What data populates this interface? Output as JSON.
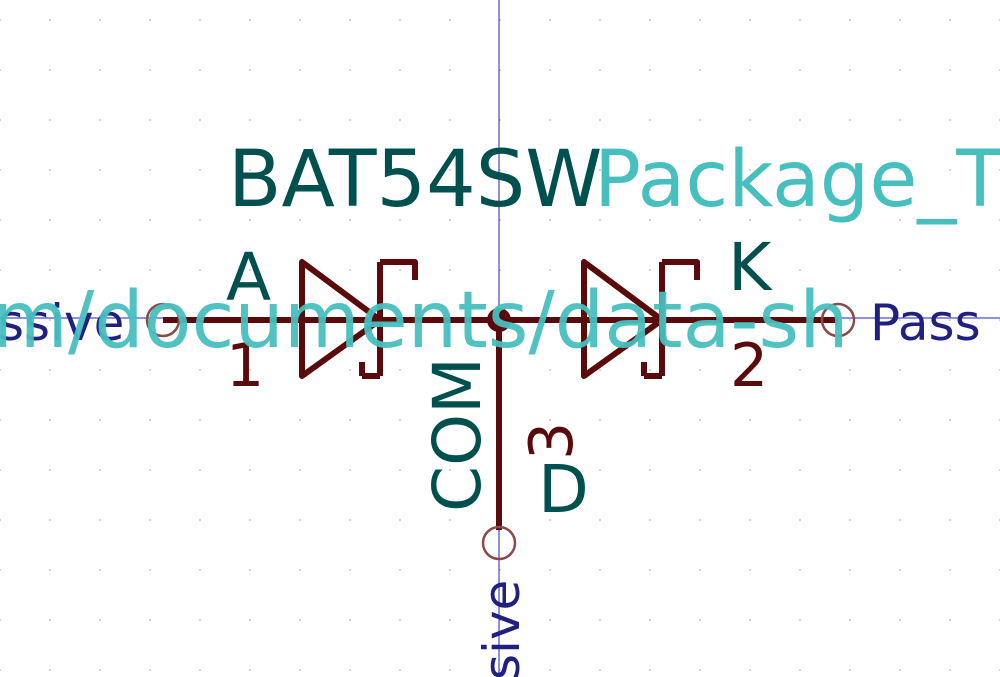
{
  "symbol": {
    "value": "BAT54SW",
    "footprint_partial": "Package_T",
    "pin_names": {
      "left": "A",
      "right": "K",
      "bottom": "D",
      "center": "COM"
    },
    "pin_numbers": {
      "left": "1",
      "right": "2",
      "bottom": "3"
    },
    "electrical_type": {
      "left": "ssive",
      "right": "Pass",
      "bottom": "sive"
    },
    "datasheet_partial": "m/documents/data-sh"
  },
  "colors": {
    "body": "#5a0a0a",
    "pin_name": "#005050",
    "field": "#48bfbf",
    "electrical_type": "#202080",
    "pin_end": "#8a4a4a",
    "crosshair": "#2020c0",
    "grid_dot": "#c8c8c8",
    "background": "#ffffff"
  }
}
